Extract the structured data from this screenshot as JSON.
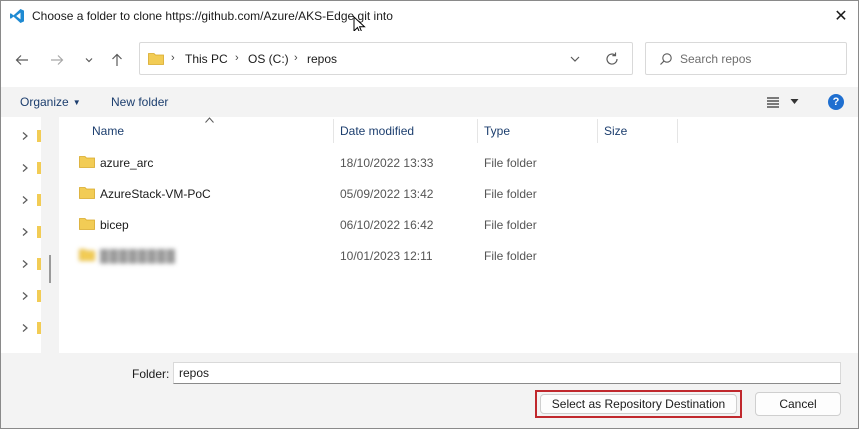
{
  "window": {
    "title": "Choose a folder to clone https://github.com/Azure/AKS-Edge.git into",
    "close_glyph": "✕"
  },
  "nav": {
    "back_glyph": "←",
    "forward_glyph": "→",
    "recent_glyph": "⌄",
    "up_glyph": "↑",
    "breadcrumb": [
      "This PC",
      "OS (C:)",
      "repos"
    ],
    "search_placeholder": "Search repos"
  },
  "commandbar": {
    "organize_label": "Organize",
    "new_folder_label": "New folder",
    "help_glyph": "?"
  },
  "columns": {
    "name": "Name",
    "date_modified": "Date modified",
    "type": "Type",
    "size": "Size"
  },
  "files": [
    {
      "name": "azure_arc",
      "date": "18/10/2022 13:33",
      "type": "File folder"
    },
    {
      "name": "AzureStack-VM-PoC",
      "date": "05/09/2022 13:42",
      "type": "File folder"
    },
    {
      "name": "bicep",
      "date": "06/10/2022 16:42",
      "type": "File folder"
    },
    {
      "name": "████████",
      "date": "10/01/2023 12:11",
      "type": "File folder",
      "redacted": true
    }
  ],
  "bottom": {
    "folder_label": "Folder:",
    "folder_value": "repos",
    "select_button": "Select as Repository Destination",
    "cancel_button": "Cancel"
  },
  "colors": {
    "accent": "#1f6fd0",
    "folder": "#f2cc55",
    "highlight_border": "#c0282d",
    "link_text": "#1c3e6e"
  },
  "icons": [
    "vscode-icon",
    "close-icon",
    "cursor-icon",
    "back-arrow-icon",
    "forward-arrow-icon",
    "chevron-down-icon",
    "up-arrow-icon",
    "folder-icon",
    "refresh-icon",
    "search-icon",
    "view-list-icon",
    "help-icon",
    "chevron-right-icon"
  ]
}
